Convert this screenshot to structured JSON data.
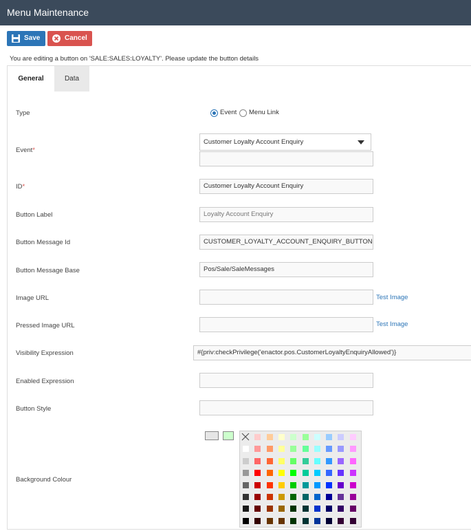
{
  "app": {
    "title": "Menu Maintenance"
  },
  "toolbar": {
    "save_label": "Save",
    "cancel_label": "Cancel"
  },
  "info_text": "You are editing a button on 'SALE:SALES:LOYALTY'. Please update the button details",
  "tabs": [
    {
      "label": "General",
      "active": true
    },
    {
      "label": "Data",
      "active": false
    }
  ],
  "form": {
    "type": {
      "label": "Type",
      "options": [
        "Event",
        "Menu Link"
      ],
      "selected": "Event"
    },
    "event": {
      "label": "Event",
      "required_mark": "*",
      "value": "Customer Loyalty Account Enquiry",
      "secondary_value": ""
    },
    "id": {
      "label": "ID",
      "required_mark": "*",
      "value": "Customer Loyalty Account Enquiry"
    },
    "button_label": {
      "label": "Button Label",
      "placeholder": "Loyalty Account Enquiry",
      "value": ""
    },
    "button_message_id": {
      "label": "Button Message Id",
      "value": "CUSTOMER_LOYALTY_ACCOUNT_ENQUIRY_BUTTON"
    },
    "button_message_base": {
      "label": "Button Message Base",
      "value": "Pos/Sale/SaleMessages"
    },
    "image_url": {
      "label": "Image URL",
      "value": "",
      "link": "Test Image"
    },
    "pressed_image_url": {
      "label": "Pressed Image URL",
      "value": "",
      "link": "Test Image"
    },
    "visibility_expression": {
      "label": "Visibility Expression",
      "value": "#{priv:checkPrivilege('enactor.pos.CustomerLoyaltyEnquiryAllowed')}"
    },
    "enabled_expression": {
      "label": "Enabled Expression",
      "value": ""
    },
    "button_style": {
      "label": "Button Style",
      "value": ""
    },
    "background_colour": {
      "label": "Background Colour",
      "current_colours": [
        "#e6e6e6",
        "#ccffcc"
      ],
      "no_colour_icon": "x-icon",
      "palette": [
        [
          "#ffffff",
          "#ffcccc",
          "#ffcc99",
          "#ffffcc",
          "#ccffcc",
          "#99ff99",
          "#ccffff",
          "#99ccff",
          "#ccccff",
          "#ffccff"
        ],
        [
          "#ffffff",
          "#ff9999",
          "#ff9966",
          "#ffff99",
          "#99ff99",
          "#66ff99",
          "#99ffff",
          "#6699ff",
          "#9999ff",
          "#ff99ff"
        ],
        [
          "#cccccc",
          "#ff6666",
          "#ff6633",
          "#ffff66",
          "#66ff66",
          "#33cc99",
          "#66ffff",
          "#3399ff",
          "#9966ff",
          "#ff66ff"
        ],
        [
          "#999999",
          "#ff0000",
          "#ff6600",
          "#ffff00",
          "#00ff00",
          "#00cc99",
          "#00ccff",
          "#3366ff",
          "#6633ff",
          "#cc33ff"
        ],
        [
          "#666666",
          "#cc0000",
          "#ff3300",
          "#ffcc00",
          "#00cc00",
          "#009999",
          "#0099ff",
          "#0033ff",
          "#6600cc",
          "#cc00cc"
        ],
        [
          "#333333",
          "#990000",
          "#cc3300",
          "#cc9900",
          "#006600",
          "#006666",
          "#0066cc",
          "#000099",
          "#663399",
          "#990099"
        ],
        [
          "#1a1a1a",
          "#660000",
          "#993300",
          "#996600",
          "#003300",
          "#003333",
          "#0033cc",
          "#000066",
          "#330066",
          "#660066"
        ],
        [
          "#000000",
          "#330000",
          "#663300",
          "#663300",
          "#003300",
          "#003333",
          "#003399",
          "#000033",
          "#330033",
          "#330033"
        ]
      ]
    }
  }
}
